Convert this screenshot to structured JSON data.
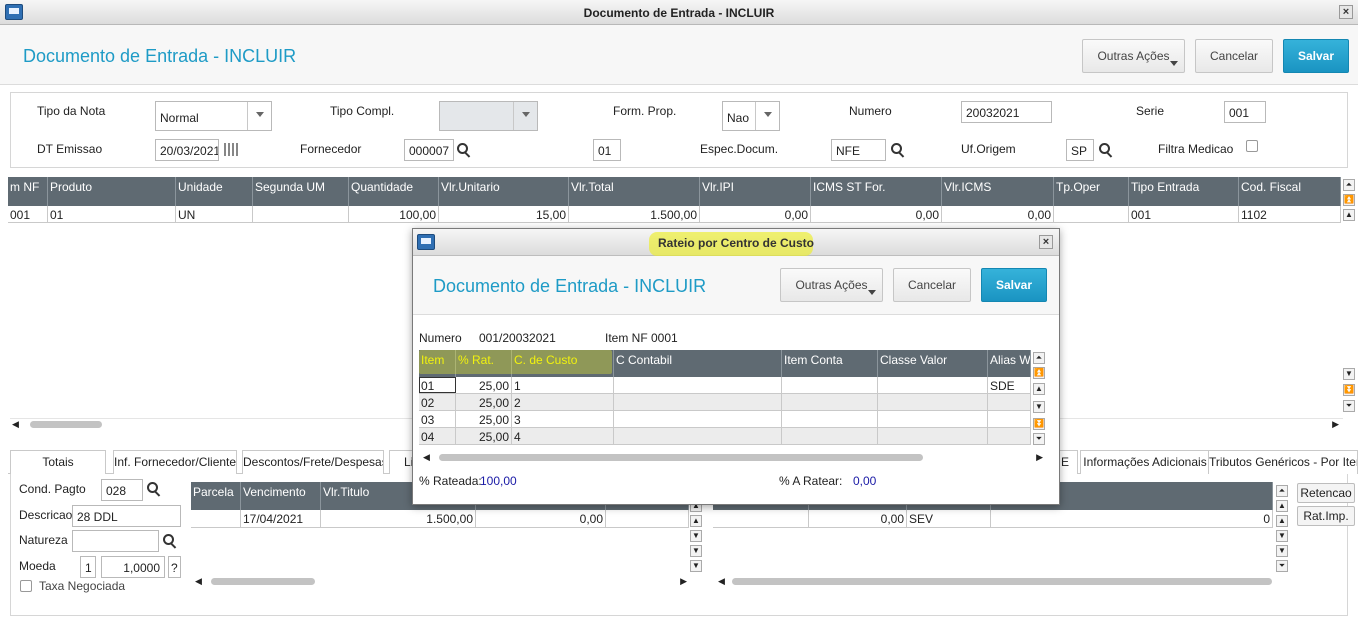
{
  "window": {
    "title": "Documento de Entrada - INCLUIR"
  },
  "header": {
    "title": "Documento de Entrada - INCLUIR",
    "buttons": {
      "other": "Outras Ações",
      "cancel": "Cancelar",
      "save": "Salvar"
    }
  },
  "form": {
    "tipo_nota": {
      "label": "Tipo da Nota",
      "value": "Normal"
    },
    "tipo_compl": {
      "label": "Tipo Compl.",
      "value": ""
    },
    "form_prop": {
      "label": "Form. Prop.",
      "value": "Nao"
    },
    "numero": {
      "label": "Numero",
      "value": "20032021"
    },
    "serie": {
      "label": "Serie",
      "value": "001"
    },
    "dt_emissao": {
      "label": "DT Emissao",
      "value": "20/03/2021"
    },
    "fornecedor": {
      "label": "Fornecedor",
      "value": "000007",
      "loja": "01"
    },
    "espec_docum": {
      "label": "Espec.Docum.",
      "value": "NFE"
    },
    "uf_origem": {
      "label": "Uf.Origem",
      "value": "SP"
    },
    "filtra_medicao": {
      "label": "Filtra Medicao",
      "checked": false
    }
  },
  "items_grid": {
    "columns": [
      "m NF",
      "Produto",
      "Unidade",
      "Segunda UM",
      "Quantidade",
      "Vlr.Unitario",
      "Vlr.Total",
      "Vlr.IPI",
      "ICMS ST For.",
      "Vlr.ICMS",
      "Tp.Oper",
      "Tipo Entrada",
      "Cod. Fiscal"
    ],
    "rows": [
      [
        "001",
        "01",
        "UN",
        "",
        "100,00",
        "15,00",
        "1.500,00",
        "0,00",
        "0,00",
        "0,00",
        "",
        "001",
        "1102"
      ]
    ]
  },
  "tabs": [
    "Totais",
    "Inf. Fornecedor/Cliente",
    "Descontos/Frete/Despesas",
    "Li",
    "E",
    "Informações Adicionais",
    "Tributos Genéricos - Por Item"
  ],
  "bottom": {
    "cond_pagto": {
      "label": "Cond. Pagto",
      "value": "028"
    },
    "descricao": {
      "label": "Descricao",
      "value": "28 DDL"
    },
    "natureza": {
      "label": "Natureza",
      "value": ""
    },
    "moeda": {
      "label": "Moeda",
      "value": "1",
      "rate": "1,0000",
      "help": "?"
    },
    "taxa_negociada": {
      "label": "Taxa Negociada",
      "checked": false
    },
    "parcelas": {
      "columns": [
        "Parcela",
        "Vencimento",
        "Vlr.Titulo"
      ],
      "rows": [
        [
          "",
          "17/04/2021",
          "1.500,00",
          "0,00",
          ""
        ]
      ]
    },
    "right_row": [
      "0,00",
      "SEV",
      "0"
    ],
    "buttons": {
      "retencao": "Retencao",
      "rat_imp": "Rat.Imp."
    }
  },
  "modal": {
    "title": "Rateio por Centro de Custo",
    "header_title": "Documento de Entrada - INCLUIR",
    "buttons": {
      "other": "Outras Ações",
      "cancel": "Cancelar",
      "save": "Salvar"
    },
    "numero_label": "Numero",
    "numero_value": "001/20032021",
    "item_nf": "Item NF 0001",
    "columns": [
      "Item",
      "% Rat.",
      "C. de Custo",
      "C Contabil",
      "Item Conta",
      "Classe Valor",
      "Alias WT"
    ],
    "rows": [
      [
        "01",
        "25,00",
        "1",
        "",
        "",
        "",
        "SDE"
      ],
      [
        "02",
        "25,00",
        "2",
        "",
        "",
        "",
        ""
      ],
      [
        "03",
        "25,00",
        "3",
        "",
        "",
        "",
        ""
      ],
      [
        "04",
        "25,00",
        "4",
        "",
        "",
        "",
        ""
      ]
    ],
    "rateada_label": "% Rateada:",
    "rateada_value": "100,00",
    "a_ratear_label": "% A Ratear:",
    "a_ratear_value": "0,00"
  },
  "colors": {
    "accent": "#1e9bc6",
    "grid_header": "#5f6a72",
    "highlight": "#ecee28",
    "link_value": "#1a1aa6"
  }
}
